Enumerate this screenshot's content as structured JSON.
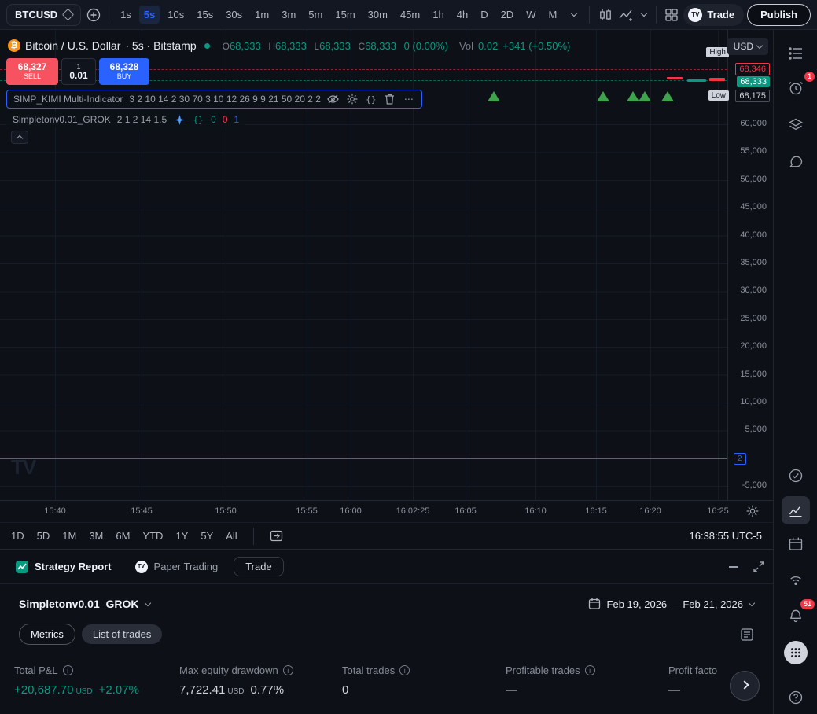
{
  "colors": {
    "accent_blue": "#2962ff",
    "up_teal": "#089981",
    "down_red": "#f23645",
    "sell_red": "#f7525f",
    "buy_blue": "#2962ff",
    "marker_green": "#3fa34d"
  },
  "toolbar": {
    "symbol": "BTCUSD",
    "timeframes": [
      "1s",
      "5s",
      "10s",
      "15s",
      "30s",
      "1m",
      "3m",
      "5m",
      "15m",
      "30m",
      "45m",
      "1h",
      "4h",
      "D",
      "2D",
      "W",
      "M"
    ],
    "active_timeframe": "5s",
    "trade_label": "Trade",
    "publish_label": "Publish"
  },
  "chart": {
    "header": {
      "symbol_name": "Bitcoin / U.S. Dollar",
      "interval_exchange": "· 5s · Bitstamp",
      "o_label": "O",
      "o": "68,333",
      "h_label": "H",
      "h": "68,333",
      "l_label": "L",
      "l": "68,333",
      "c_label": "C",
      "c": "68,333",
      "change": "0 (0.00%)",
      "vol_label": "Vol",
      "vol": "0.02",
      "vol_change": "+341 (+0.50%)"
    },
    "currency": "USD",
    "order_panel": {
      "sell_price": "68,327",
      "sell_label": "SELL",
      "spread": "1",
      "qty": "0.01",
      "buy_price": "68,328",
      "buy_label": "BUY"
    },
    "indicator1": {
      "title": "SIMP_KIMI Multi-Indicator",
      "params": "3 2 10 14 2 30 70 3 10 12 26 9 9 21 50 20 2 2"
    },
    "indicator2": {
      "title": "Simpletonv0.01_GROK",
      "params": "2 1 2 14 1.5",
      "v1": "0",
      "v2": "0",
      "v3": "1"
    },
    "price_axis": {
      "high_label": "High",
      "countdown": "68,346",
      "last": "68,333",
      "low_label": "Low",
      "low_value": "68,175",
      "ticks": [
        "60,000",
        "55,000",
        "50,000",
        "45,000",
        "40,000",
        "35,000",
        "30,000",
        "25,000",
        "20,000",
        "15,000",
        "10,000",
        "5,000",
        "-5,000"
      ],
      "baseline_badge": "2"
    },
    "time_axis": [
      "15:40",
      "15:45",
      "15:50",
      "15:55",
      "16:00",
      "16:02:25",
      "16:05",
      "16:10",
      "16:15",
      "16:20",
      "16:25"
    ],
    "buy_marker_count": 5
  },
  "range_bar": {
    "items": [
      "1D",
      "5D",
      "1M",
      "3M",
      "6M",
      "YTD",
      "1Y",
      "5Y",
      "All"
    ],
    "clock": "16:38:55 UTC-5"
  },
  "report": {
    "tab_strategy": "Strategy Report",
    "tab_paper": "Paper Trading",
    "trade_button": "Trade",
    "strategy_name": "Simpletonv0.01_GROK",
    "date_range": "Feb 19, 2026 — Feb 21, 2026",
    "metrics_button": "Metrics",
    "trades_button": "List of trades",
    "metrics": {
      "m1_label": "Total P&L",
      "m1_value": "+20,687.70",
      "m1_unit": "USD",
      "m1_extra": "+2.07%",
      "m2_label": "Max equity drawdown",
      "m2_value": "7,722.41",
      "m2_unit": "USD",
      "m2_extra": "0.77%",
      "m3_label": "Total trades",
      "m3_value": "0",
      "m4_label": "Profitable trades",
      "m4_value": "—",
      "m5_label": "Profit facto",
      "m5_value": "—"
    }
  },
  "sidebar": {
    "alerts_badge": "1",
    "notifications_badge": "51"
  },
  "icons": {
    "braces": "{}",
    "info": "i",
    "question": "?",
    "more": "⋯",
    "btc": "₿",
    "tv_logo": "TV"
  }
}
